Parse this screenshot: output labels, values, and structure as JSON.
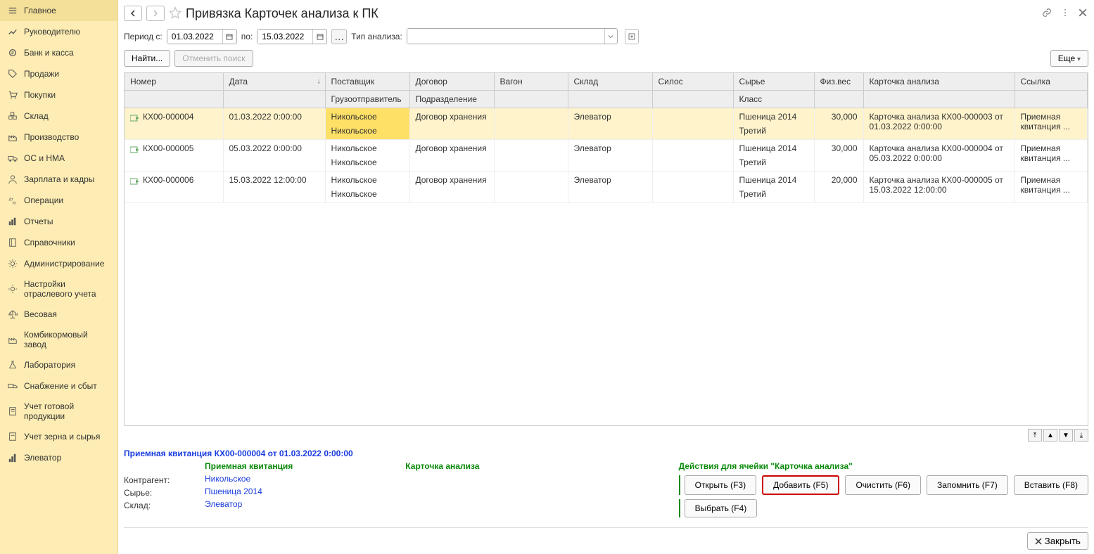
{
  "sidebar": {
    "items": [
      {
        "label": "Главное",
        "icon": "menu"
      },
      {
        "label": "Руководителю",
        "icon": "trend"
      },
      {
        "label": "Банк и касса",
        "icon": "coin"
      },
      {
        "label": "Продажи",
        "icon": "tag"
      },
      {
        "label": "Покупки",
        "icon": "cart"
      },
      {
        "label": "Склад",
        "icon": "boxes"
      },
      {
        "label": "Производство",
        "icon": "factory"
      },
      {
        "label": "ОС и НМА",
        "icon": "truck"
      },
      {
        "label": "Зарплата и кадры",
        "icon": "person"
      },
      {
        "label": "Операции",
        "icon": "ops"
      },
      {
        "label": "Отчеты",
        "icon": "chart"
      },
      {
        "label": "Справочники",
        "icon": "book"
      },
      {
        "label": "Администрирование",
        "icon": "gear"
      },
      {
        "label": "Настройки отраслевого учета",
        "icon": "gear2"
      },
      {
        "label": "Весовая",
        "icon": "scale"
      },
      {
        "label": "Комбикормовый завод",
        "icon": "factory2"
      },
      {
        "label": "Лаборатория",
        "icon": "flask"
      },
      {
        "label": "Снабжение и сбыт",
        "icon": "truck2"
      },
      {
        "label": "Учет готовой продукции",
        "icon": "doc"
      },
      {
        "label": "Учет зерна и сырья",
        "icon": "doc2"
      },
      {
        "label": "Элеватор",
        "icon": "elevator"
      }
    ]
  },
  "header": {
    "title": "Привязка Карточек анализа к ПК"
  },
  "filter": {
    "period_label": "Период с:",
    "date_from": "01.03.2022",
    "to_label": "по:",
    "date_to": "15.03.2022",
    "type_label": "Тип анализа:",
    "type_value": ""
  },
  "search": {
    "find": "Найти...",
    "cancel": "Отменить поиск",
    "more": "Еще"
  },
  "table": {
    "headers_row1": [
      "Номер",
      "Дата",
      "Поставщик",
      "Договор",
      "Вагон",
      "Склад",
      "Силос",
      "Сырье",
      "Физ.вес",
      "Карточка анализа",
      "Ссылка"
    ],
    "headers_row2": [
      "",
      "",
      "Грузоотправитель",
      "Подразделение",
      "",
      "",
      "",
      "Класс",
      "",
      "",
      ""
    ],
    "sort_col": 1,
    "rows": [
      {
        "selected": true,
        "number": "КХ00-000004",
        "date": "01.03.2022 0:00:00",
        "supplier": "Никольское",
        "consignor": "Никольское",
        "contract": "Договор хранения",
        "dept": "",
        "wagon": "",
        "warehouse": "Элеватор",
        "silo": "",
        "raw": "Пшеница 2014",
        "class": "Третий",
        "weight": "30,000",
        "card": "Карточка анализа КХ00-000003 от 01.03.2022 0:00:00",
        "link": "Приемная квитанция ..."
      },
      {
        "selected": false,
        "number": "КХ00-000005",
        "date": "05.03.2022 0:00:00",
        "supplier": "Никольское",
        "consignor": "Никольское",
        "contract": "Договор хранения",
        "dept": "",
        "wagon": "",
        "warehouse": "Элеватор",
        "silo": "",
        "raw": "Пшеница 2014",
        "class": "Третий",
        "weight": "30,000",
        "card": "Карточка анализа КХ00-000004 от 05.03.2022 0:00:00",
        "link": "Приемная квитанция ..."
      },
      {
        "selected": false,
        "number": "КХ00-000006",
        "date": "15.03.2022 12:00:00",
        "supplier": "Никольское",
        "consignor": "Никольское",
        "contract": "Договор хранения",
        "dept": "",
        "wagon": "",
        "warehouse": "Элеватор",
        "silo": "",
        "raw": "Пшеница 2014",
        "class": "Третий",
        "weight": "20,000",
        "card": "Карточка анализа КХ00-000005 от 15.03.2022 12:00:00",
        "link": "Приемная квитанция ..."
      }
    ]
  },
  "details": {
    "doc_link": "Приемная квитанция КХ00-000004 от 01.03.2022 0:00:00",
    "left_header": "Приемная квитанция",
    "contragent_label": "Контрагент:",
    "contragent_value": "Никольское",
    "raw_label": "Сырье:",
    "raw_value": "Пшеница 2014",
    "warehouse_label": "Склад:",
    "warehouse_value": "Элеватор",
    "card_header": "Карточка анализа",
    "actions_header": "Действия для ячейки \"Карточка анализа\"",
    "actions": {
      "open": "Открыть (F3)",
      "add": "Добавить (F5)",
      "clear": "Очистить (F6)",
      "remember": "Запомнить (F7)",
      "paste": "Вставить (F8)",
      "select": "Выбрать (F4)"
    }
  },
  "bottom": {
    "close": "Закрыть"
  }
}
